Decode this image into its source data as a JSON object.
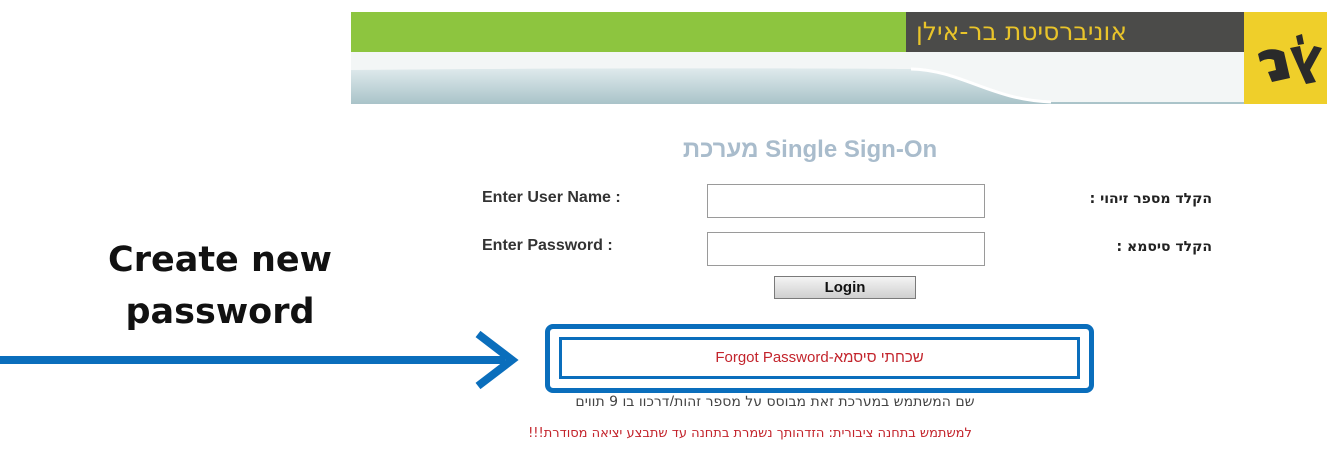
{
  "header": {
    "university_name": "אוניברסיטת בר-אילן",
    "logo_glyph": "בא",
    "colors": {
      "green": "#8dc53f",
      "dark": "#4b4b49",
      "gold": "#efcf2a"
    }
  },
  "page_title": "Single Sign-On מערכת",
  "form": {
    "username_label": "Enter User Name :",
    "username_label_he": "הקלד מספר זיהוי :",
    "username_value": "",
    "password_label": "Enter Password :",
    "password_label_he": "הקלד סיסמא :",
    "password_value": "",
    "login_label": "Login"
  },
  "forgot_link": "Forgot Password-שכחתי סיסמא",
  "notes": {
    "username_hint": "שם המשתמש במערכת זאת מבוסס על מספר זהות/דרכון בן 9 תווים",
    "public_station_warning": "למשתמש בתחנה ציבורית: הזדהותך נשמרת בתחנה עד שתבצע יציאה מסודרת!!!"
  },
  "annotation": {
    "callout_line1": "Create new",
    "callout_line2": "password",
    "accent_color": "#0a6ebc"
  }
}
